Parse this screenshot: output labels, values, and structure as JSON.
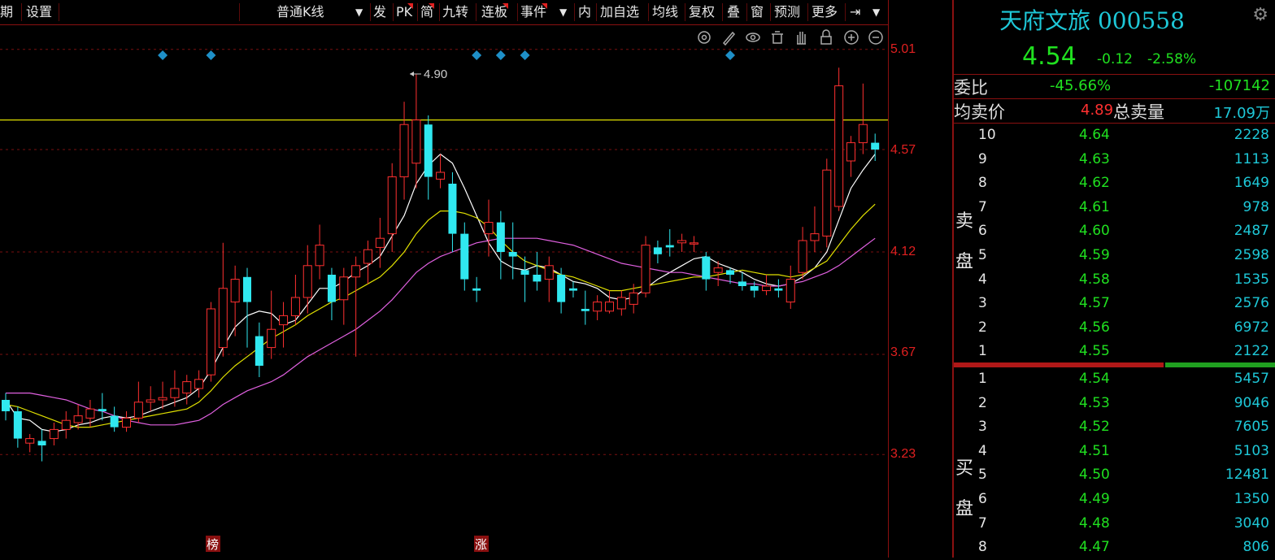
{
  "toolbar": {
    "items": [
      "期",
      "设置",
      "普通K线",
      "发",
      "PK",
      "简",
      "九转",
      "连板",
      "事件",
      "内",
      "加自选",
      "均线",
      "复权",
      "叠",
      "窗",
      "预测",
      "更多"
    ]
  },
  "chart": {
    "price_axis_labels": [
      "5.01",
      "4.57",
      "4.12",
      "3.67",
      "3.23"
    ],
    "high_annotation": "4.90",
    "event_markers": [
      "榜",
      "涨"
    ]
  },
  "chart_data": {
    "type": "candlestick",
    "y_range": [
      3.0,
      5.2
    ],
    "reference_line": 4.7,
    "candles": [
      [
        3.47,
        3.42,
        3.5,
        3.38
      ],
      [
        3.42,
        3.3,
        3.44,
        3.26
      ],
      [
        3.28,
        3.3,
        3.32,
        3.24
      ],
      [
        3.29,
        3.27,
        3.34,
        3.2
      ],
      [
        3.3,
        3.34,
        3.37,
        3.27
      ],
      [
        3.34,
        3.38,
        3.42,
        3.3
      ],
      [
        3.37,
        3.4,
        3.45,
        3.34
      ],
      [
        3.39,
        3.43,
        3.47,
        3.35
      ],
      [
        3.43,
        3.42,
        3.5,
        3.38
      ],
      [
        3.4,
        3.35,
        3.44,
        3.33
      ],
      [
        3.35,
        3.39,
        3.42,
        3.33
      ],
      [
        3.39,
        3.46,
        3.55,
        3.37
      ],
      [
        3.46,
        3.47,
        3.53,
        3.42
      ],
      [
        3.47,
        3.48,
        3.55,
        3.43
      ],
      [
        3.48,
        3.52,
        3.6,
        3.44
      ],
      [
        3.5,
        3.55,
        3.58,
        3.45
      ],
      [
        3.52,
        3.56,
        3.6,
        3.48
      ],
      [
        3.58,
        3.87,
        3.9,
        3.55
      ],
      [
        3.7,
        3.96,
        4.16,
        3.66
      ],
      [
        3.9,
        4.0,
        4.06,
        3.75
      ],
      [
        4.01,
        3.9,
        4.05,
        3.7
      ],
      [
        3.75,
        3.62,
        3.81,
        3.57
      ],
      [
        3.7,
        3.78,
        3.95,
        3.65
      ],
      [
        3.8,
        3.84,
        3.9,
        3.7
      ],
      [
        3.84,
        3.92,
        4.02,
        3.8
      ],
      [
        3.92,
        4.06,
        4.15,
        3.85
      ],
      [
        4.06,
        4.15,
        4.24,
        4.0
      ],
      [
        4.02,
        3.9,
        4.05,
        3.82
      ],
      [
        3.91,
        4.01,
        4.05,
        3.8
      ],
      [
        4.01,
        4.06,
        4.1,
        3.66
      ],
      [
        4.07,
        4.13,
        4.17,
        3.98
      ],
      [
        4.14,
        4.18,
        4.27,
        4.05
      ],
      [
        4.2,
        4.45,
        4.51,
        4.12
      ],
      [
        4.45,
        4.68,
        4.78,
        4.35
      ],
      [
        4.51,
        4.7,
        4.9,
        4.4
      ],
      [
        4.68,
        4.45,
        4.72,
        4.35
      ],
      [
        4.44,
        4.47,
        4.55,
        4.4
      ],
      [
        4.42,
        4.2,
        4.47,
        4.12
      ],
      [
        4.2,
        4.0,
        4.25,
        3.95
      ],
      [
        3.96,
        3.95,
        4.01,
        3.9
      ],
      [
        4.2,
        4.25,
        4.35,
        4.1
      ],
      [
        4.25,
        4.12,
        4.3,
        4.0
      ],
      [
        4.12,
        4.1,
        4.25,
        4.0
      ],
      [
        4.04,
        4.02,
        4.1,
        3.9
      ],
      [
        4.02,
        3.99,
        4.12,
        3.95
      ],
      [
        4.0,
        4.06,
        4.1,
        3.9
      ],
      [
        4.02,
        3.9,
        4.05,
        3.85
      ],
      [
        3.96,
        3.95,
        3.99,
        3.92
      ],
      [
        3.87,
        3.86,
        3.95,
        3.8
      ],
      [
        3.86,
        3.9,
        3.93,
        3.82
      ],
      [
        3.86,
        3.9,
        3.95,
        3.85
      ],
      [
        3.87,
        3.92,
        3.95,
        3.84
      ],
      [
        3.89,
        3.94,
        3.98,
        3.85
      ],
      [
        3.94,
        4.15,
        4.19,
        3.92
      ],
      [
        4.14,
        4.11,
        4.17,
        4.07
      ],
      [
        4.15,
        4.14,
        4.22,
        4.1
      ],
      [
        4.16,
        4.17,
        4.2,
        4.12
      ],
      [
        4.16,
        4.16,
        4.19,
        4.12
      ],
      [
        4.1,
        4.0,
        4.12,
        3.95
      ],
      [
        4.03,
        4.05,
        4.08,
        3.97
      ],
      [
        4.04,
        4.02,
        4.05,
        3.98
      ],
      [
        3.99,
        3.97,
        4.03,
        3.95
      ],
      [
        3.97,
        3.95,
        3.99,
        3.92
      ],
      [
        3.95,
        3.97,
        4.02,
        3.93
      ],
      [
        3.96,
        3.95,
        4.0,
        3.92
      ],
      [
        3.9,
        4.0,
        4.06,
        3.87
      ],
      [
        4.03,
        4.17,
        4.23,
        4.0
      ],
      [
        4.17,
        4.2,
        4.32,
        4.12
      ],
      [
        4.19,
        4.48,
        4.53,
        4.14
      ],
      [
        4.32,
        4.85,
        4.93,
        4.3
      ],
      [
        4.52,
        4.6,
        4.63,
        4.45
      ],
      [
        4.6,
        4.68,
        4.86,
        4.55
      ],
      [
        4.6,
        4.57,
        4.64,
        4.52
      ]
    ],
    "ma_series": [
      {
        "color": "#ffffff",
        "values": [
          3.47,
          3.39,
          3.38,
          3.34,
          3.33,
          3.34,
          3.36,
          3.37,
          3.39,
          3.4,
          3.39,
          3.4,
          3.42,
          3.44,
          3.46,
          3.48,
          3.52,
          3.6,
          3.7,
          3.79,
          3.84,
          3.86,
          3.85,
          3.8,
          3.82,
          3.89,
          3.96,
          3.96,
          3.99,
          4.03,
          4.06,
          4.1,
          4.19,
          4.28,
          4.42,
          4.5,
          4.55,
          4.51,
          4.4,
          4.28,
          4.16,
          4.08,
          4.05,
          4.04,
          4.06,
          4.05,
          4.02,
          3.99,
          3.98,
          3.96,
          3.92,
          3.91,
          3.92,
          3.96,
          4.0,
          4.03,
          4.06,
          4.09,
          4.1,
          4.07,
          4.05,
          4.03,
          4.0,
          3.98,
          3.97,
          3.98,
          4.01,
          4.05,
          4.12,
          4.26,
          4.4,
          4.48,
          4.55
        ]
      },
      {
        "color": "#e0e000",
        "values": [
          3.45,
          3.44,
          3.42,
          3.4,
          3.38,
          3.36,
          3.35,
          3.35,
          3.36,
          3.37,
          3.38,
          3.39,
          3.4,
          3.41,
          3.42,
          3.43,
          3.46,
          3.51,
          3.57,
          3.62,
          3.66,
          3.7,
          3.74,
          3.77,
          3.8,
          3.84,
          3.87,
          3.9,
          3.92,
          3.95,
          3.98,
          4.01,
          4.06,
          4.12,
          4.2,
          4.26,
          4.3,
          4.3,
          4.29,
          4.27,
          4.23,
          4.17,
          4.12,
          4.08,
          4.06,
          4.04,
          4.02,
          4.01,
          3.99,
          3.97,
          3.95,
          3.95,
          3.96,
          3.97,
          3.98,
          3.99,
          4.0,
          4.01,
          4.01,
          4.02,
          4.03,
          4.04,
          4.03,
          4.02,
          4.02,
          4.01,
          4.02,
          4.05,
          4.08,
          4.15,
          4.22,
          4.28,
          4.33
        ]
      },
      {
        "color": "#e060e0",
        "values": [
          3.5,
          3.5,
          3.5,
          3.49,
          3.48,
          3.47,
          3.45,
          3.43,
          3.42,
          3.4,
          3.38,
          3.37,
          3.36,
          3.36,
          3.36,
          3.37,
          3.38,
          3.41,
          3.45,
          3.48,
          3.51,
          3.53,
          3.55,
          3.58,
          3.62,
          3.66,
          3.69,
          3.72,
          3.75,
          3.78,
          3.82,
          3.86,
          3.91,
          3.97,
          4.03,
          4.07,
          4.1,
          4.12,
          4.14,
          4.16,
          4.17,
          4.18,
          4.18,
          4.18,
          4.18,
          4.17,
          4.16,
          4.15,
          4.13,
          4.11,
          4.09,
          4.07,
          4.06,
          4.05,
          4.04,
          4.03,
          4.03,
          4.02,
          4.01,
          4.0,
          3.99,
          3.98,
          3.98,
          3.97,
          3.97,
          3.98,
          3.99,
          4.01,
          4.03,
          4.06,
          4.1,
          4.14,
          4.18
        ]
      }
    ]
  },
  "quote": {
    "name_code": "天府文旅 000558",
    "price": "4.54",
    "change": "-0.12",
    "change_pct": "-2.58%",
    "webi_label": "委比",
    "webi_pct": "-45.66%",
    "webi_diff": "-107142",
    "avg_sell_label": "均卖价",
    "avg_sell_price": "4.89",
    "total_sell_label": "总卖量",
    "total_sell_vol": "17.09万",
    "sell_label": [
      "卖",
      "盘"
    ],
    "buy_label": [
      "买",
      "盘"
    ],
    "sell_levels": [
      {
        "lvl": "10",
        "price": "4.64",
        "vol": "2228"
      },
      {
        "lvl": "9",
        "price": "4.63",
        "vol": "1113"
      },
      {
        "lvl": "8",
        "price": "4.62",
        "vol": "1649"
      },
      {
        "lvl": "7",
        "price": "4.61",
        "vol": "978"
      },
      {
        "lvl": "6",
        "price": "4.60",
        "vol": "2487"
      },
      {
        "lvl": "5",
        "price": "4.59",
        "vol": "2598"
      },
      {
        "lvl": "4",
        "price": "4.58",
        "vol": "1535"
      },
      {
        "lvl": "3",
        "price": "4.57",
        "vol": "2576"
      },
      {
        "lvl": "2",
        "price": "4.56",
        "vol": "6972"
      },
      {
        "lvl": "1",
        "price": "4.55",
        "vol": "2122"
      }
    ],
    "buy_levels": [
      {
        "lvl": "1",
        "price": "4.54",
        "vol": "5457"
      },
      {
        "lvl": "2",
        "price": "4.53",
        "vol": "9046"
      },
      {
        "lvl": "3",
        "price": "4.52",
        "vol": "7605"
      },
      {
        "lvl": "4",
        "price": "4.51",
        "vol": "5103"
      },
      {
        "lvl": "5",
        "price": "4.50",
        "vol": "12481"
      },
      {
        "lvl": "6",
        "price": "4.49",
        "vol": "1350"
      },
      {
        "lvl": "7",
        "price": "4.48",
        "vol": "3040"
      },
      {
        "lvl": "8",
        "price": "4.47",
        "vol": "806"
      }
    ],
    "colors": {
      "up": "#ff3030",
      "down": "#20e020",
      "cyan": "#1ec8d8"
    }
  }
}
